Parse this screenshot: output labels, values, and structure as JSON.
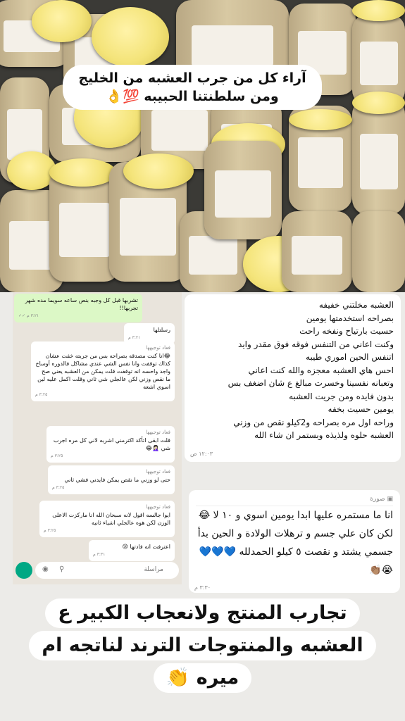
{
  "caption": {
    "line1": "آراء كل من جرب العشبه من الخليج",
    "line2": "ومن سلطنتنا الحبيبه 💯👌"
  },
  "chat_left": {
    "top_bubble": {
      "text": "تشربها قبل كل وجبه بنص ساعه سويما مده شهر تجربها!!",
      "time": "٣:٢١ م ✓✓"
    },
    "b1": {
      "text": "رسلتلها",
      "time": "٣:٢١ م"
    },
    "b2": {
      "fwd": "فعاد توجيهها",
      "text": "😂انا كنت مصدقه بصراحه بس من جربته خفت عشان كذاك توقفت وانا نفس الشي عندي مشاكل فالدوره أوساخ واجد واحسه انه توقفت قلت يمكن من العشبه يعني صح ما نقص وزني لكن عالجلي شي ثاني وقلت اكمل عليه لين اسوي اشعه",
      "time": "٣:٢٥ م"
    },
    "b3": {
      "fwd": "فعاد توجيهها",
      "text": "قلت ابقى اتأكد اكترمني اشربه لاني كل مره اجرب شي 🤦🏻‍♀️😂",
      "time": "٣:٢٥ م"
    },
    "b4": {
      "fwd": "فعاد توجيهها",
      "text": "حتى لو وزني ما نقص يمكن فايدني فشي ثاني",
      "time": "٣:٢٥ م"
    },
    "b5": {
      "fwd": "فعاد توجيهها",
      "text": "ايوا جالسه اقول لانه سبحان الله انا ماركزت الاعلى الوزن لكن هوه عالجلي اشياء ثانيه",
      "time": "٣:٢٥ م"
    },
    "b6": {
      "text": "اعترفت انه فادتها 😢",
      "time": "٣:٣١ م"
    },
    "input_placeholder": "مراسلة"
  },
  "text_card": {
    "lines": [
      "العشبه مخلتني خفيفه",
      "بصراحه استخدمتها يومين",
      "حسيت بارتياح ونفخه راحت",
      "وكنت اعاني من التنفس فوقه فوق مقدر وايد",
      "اتنفس الحين اموري طيبه",
      "احس هاي العشبه معجزه والله كنت اعاني",
      "وتعبانه نفسينا وخسرت مبالغ ع شان اضغف بس",
      "بدون فايده ومن جريت العشبه",
      "يومين حسيت بخفه",
      "وراحه اول مره بصراحه و2كيلو نقص من وزني",
      "العشبه حلوه ولذيذه وبستمر ان شاء الله"
    ],
    "time": "١٢:٠٣ ص"
  },
  "card2": {
    "header": "صورة",
    "text": "انا ما مستمره عليها ابدا يومين اسوي و ١٠ لا 😂لكن كان علي جسم و ترهلات الولادة و الحين بدأ جسمي يشتد و نقصت ٥ كيلو الحمدلله 💙💙💙😭👏🏽",
    "time": "٣:٣٠ م"
  },
  "bottom": {
    "line1": "تجارب المنتج ولانعجاب الكبير ع",
    "line2": "العشبه والمنتوجات الترند لناتجه ام",
    "line3": "ميره 👏"
  }
}
